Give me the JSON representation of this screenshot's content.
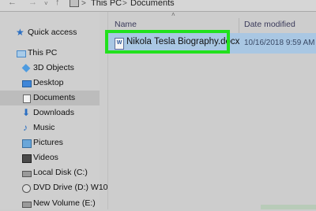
{
  "address_bar": {
    "back_glyph": "←",
    "forward_glyph": "→",
    "dropdown_glyph": "˅",
    "up_glyph": "↑",
    "separator": ">",
    "crumbs": [
      "This PC",
      "Documents"
    ]
  },
  "nav_pane": {
    "items": [
      {
        "label": "Quick access",
        "icon": "star-icon"
      },
      {
        "label": "This PC",
        "icon": "computer-icon"
      },
      {
        "label": "3D Objects",
        "icon": "cube-icon"
      },
      {
        "label": "Desktop",
        "icon": "desktop-icon"
      },
      {
        "label": "Documents",
        "icon": "documents-icon",
        "selected": true
      },
      {
        "label": "Downloads",
        "icon": "download-icon"
      },
      {
        "label": "Music",
        "icon": "music-note-icon"
      },
      {
        "label": "Pictures",
        "icon": "pictures-icon"
      },
      {
        "label": "Videos",
        "icon": "videos-icon"
      },
      {
        "label": "Local Disk (C:)",
        "icon": "disk-icon"
      },
      {
        "label": "DVD Drive (D:) W10",
        "icon": "dvd-icon"
      },
      {
        "label": "New Volume (E:)",
        "icon": "disk-icon"
      }
    ]
  },
  "file_list": {
    "columns": {
      "name": "Name",
      "date_modified": "Date modified"
    },
    "sort_glyph": "˄",
    "files": [
      {
        "name": "Nikola Tesla Biography.docx",
        "date_modified": "10/16/2018 9:59 AM",
        "type_letter": "W",
        "selected": true
      }
    ]
  },
  "colors": {
    "highlight_box": "#22e11d",
    "selection": "#a9c7e3",
    "accent_blue": "#2b6fc2"
  }
}
